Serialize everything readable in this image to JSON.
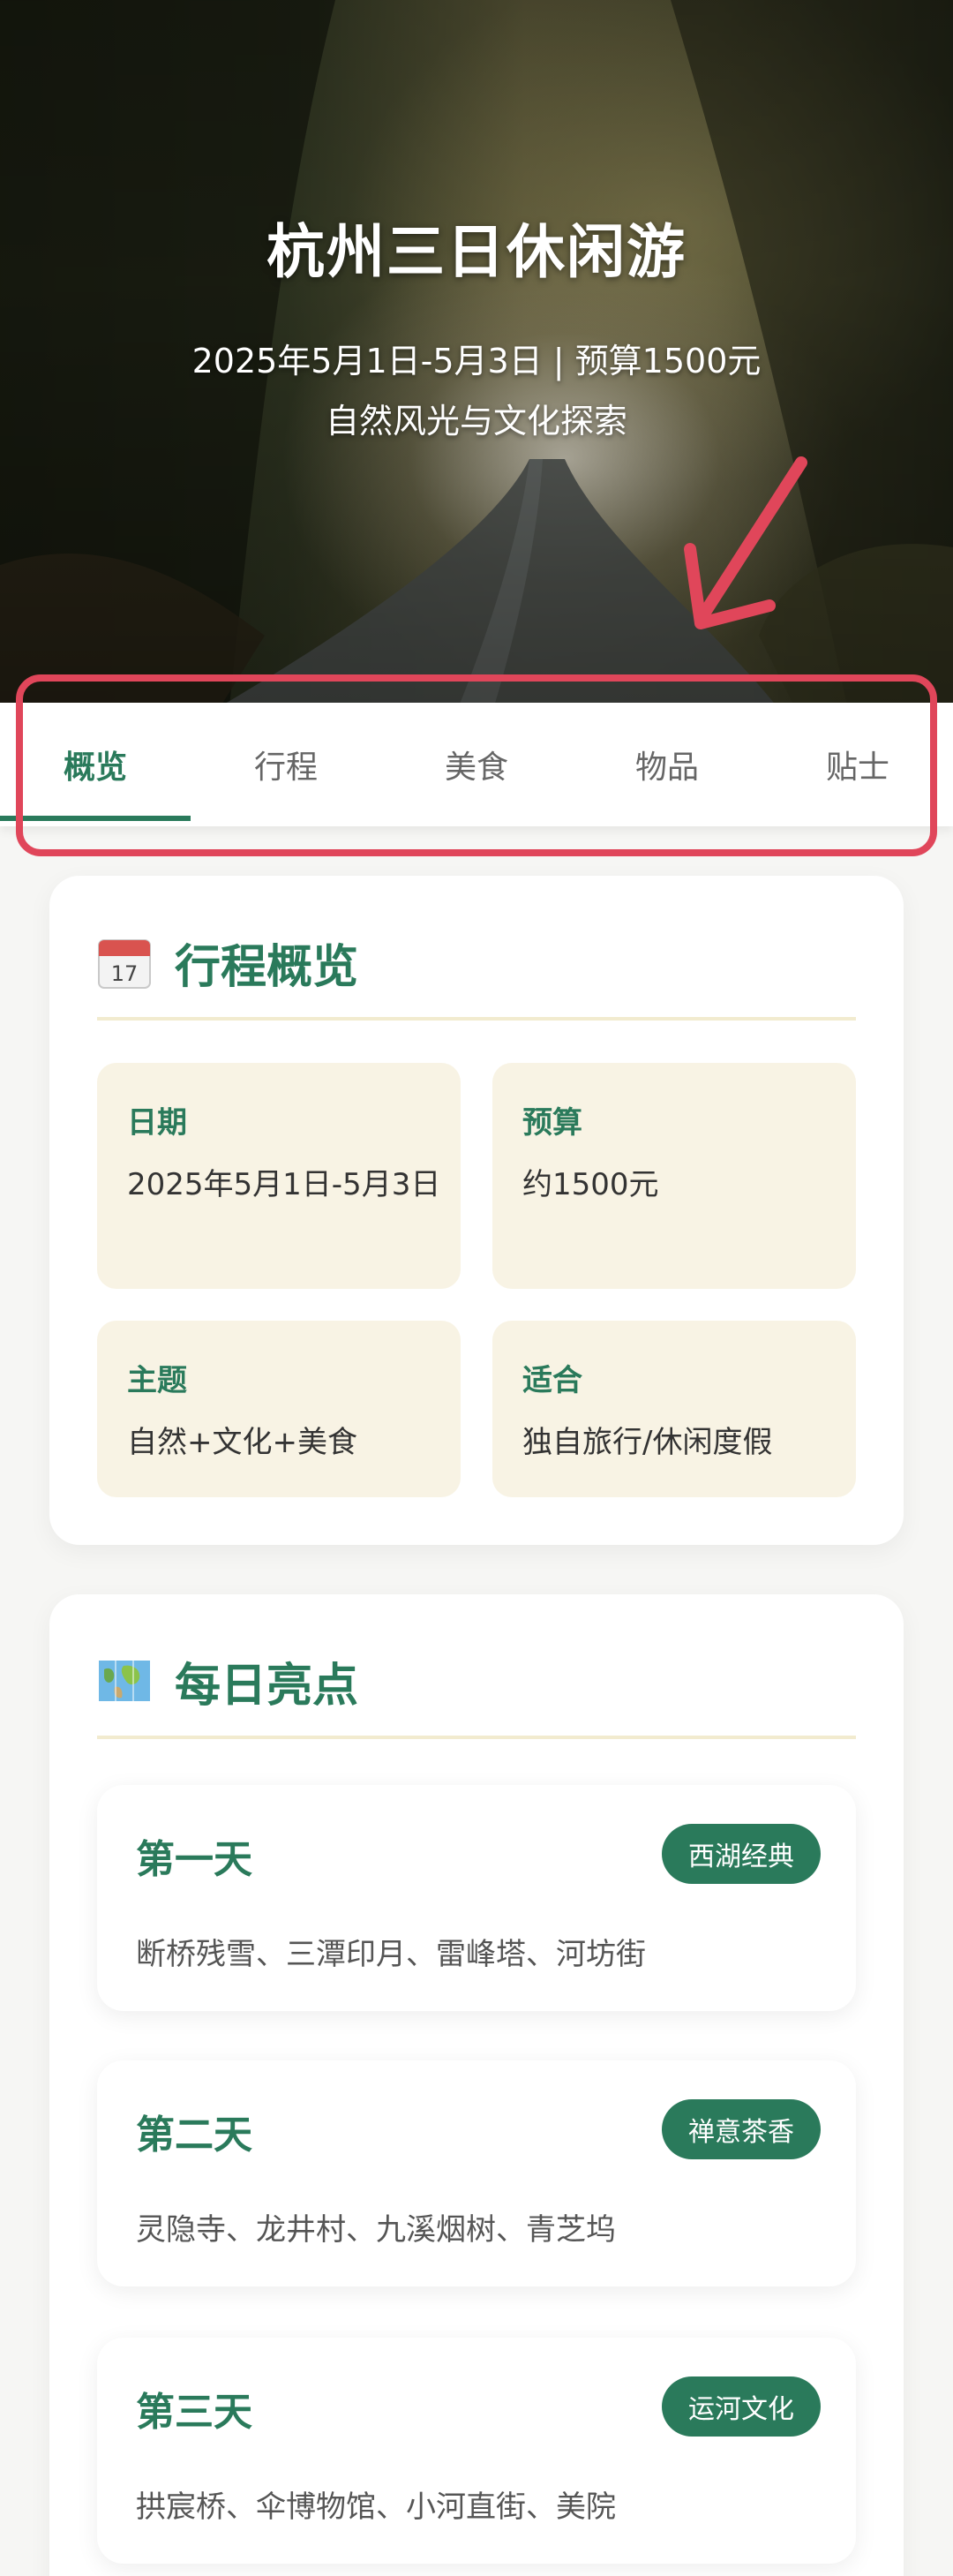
{
  "hero": {
    "title": "杭州三日休闲游",
    "subtitle_line1": "2025年5月1日-5月3日 | 预算1500元",
    "subtitle_line2": "自然风光与文化探索"
  },
  "tabs": [
    {
      "label": "概览",
      "active": true
    },
    {
      "label": "行程",
      "active": false
    },
    {
      "label": "美食",
      "active": false
    },
    {
      "label": "物品",
      "active": false
    },
    {
      "label": "贴士",
      "active": false
    }
  ],
  "overview": {
    "icon": "calendar-icon",
    "icon_text": "17",
    "title": "行程概览",
    "items": [
      {
        "label": "日期",
        "value": "2025年5月1日-5月3日"
      },
      {
        "label": "预算",
        "value": "约1500元"
      },
      {
        "label": "主题",
        "value": "自然+文化+美食"
      },
      {
        "label": "适合",
        "value": "独自旅行/休闲度假"
      }
    ]
  },
  "highlights": {
    "icon": "map-icon",
    "title": "每日亮点",
    "days": [
      {
        "title": "第一天",
        "badge": "西湖经典",
        "places": "断桥残雪、三潭印月、雷峰塔、河坊街"
      },
      {
        "title": "第二天",
        "badge": "禅意茶香",
        "places": "灵隐寺、龙井村、九溪烟树、青芝坞"
      },
      {
        "title": "第三天",
        "badge": "运河文化",
        "places": "拱宸桥、伞博物馆、小河直街、美院"
      }
    ]
  },
  "colors": {
    "accent": "#2a7a5b",
    "highlight_border": "#e0465a",
    "info_bg": "#f8f3e4"
  }
}
